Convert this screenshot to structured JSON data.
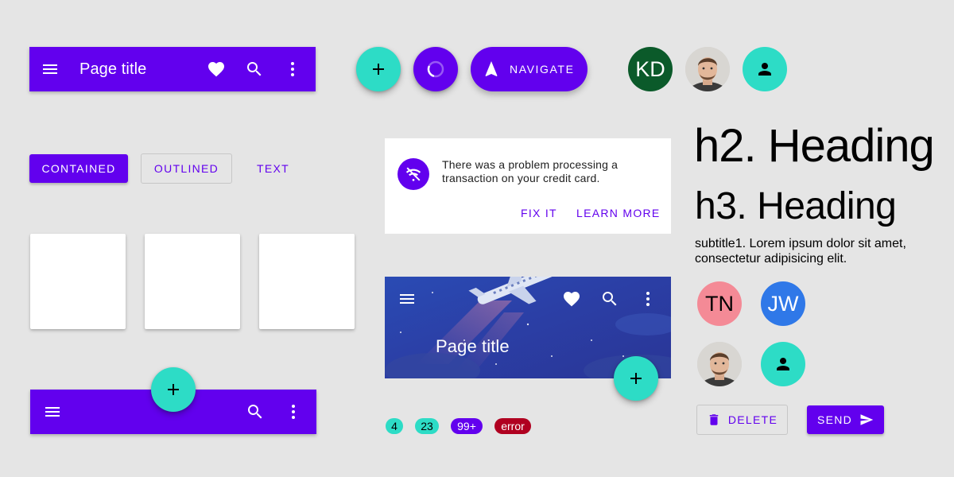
{
  "colors": {
    "primary": "#6200ee",
    "secondary": "#2ddcc6",
    "background": "#e5e5e5",
    "error": "#b00020",
    "avatar_kd": "#0b5a2a",
    "avatar_tn": "#f48a96",
    "avatar_jw": "#2f78e8"
  },
  "top_app_bar": {
    "title": "Page title",
    "icons": [
      "menu-icon",
      "favorite-icon",
      "search-icon",
      "more-vert-icon"
    ]
  },
  "fabs": {
    "add_icon": "add-icon",
    "progress_icon": "progress-icon",
    "navigate_label": "NAVIGATE",
    "navigate_icon": "navigation-arrow-icon"
  },
  "avatars_top": [
    {
      "kind": "initials",
      "text": "KD"
    },
    {
      "kind": "photo"
    },
    {
      "kind": "icon",
      "icon": "person-icon"
    }
  ],
  "buttons": {
    "contained": "CONTAINED",
    "outlined": "OUTLINED",
    "text": "TEXT"
  },
  "banner": {
    "icon": "wifi-off-icon",
    "message": "There was a problem processing a transaction on your credit card.",
    "action_fix": "FIX IT",
    "action_learn": "LEARN MORE"
  },
  "typography": {
    "h2": "h2. Heading",
    "h3": "h3. Heading",
    "subtitle1": "subtitle1. Lorem ipsum dolor sit amet, consectetur adipisicing elit."
  },
  "avatars_grid": [
    {
      "kind": "initials",
      "text": "TN"
    },
    {
      "kind": "initials",
      "text": "JW"
    },
    {
      "kind": "photo"
    },
    {
      "kind": "icon",
      "icon": "person-icon"
    }
  ],
  "prominent_app_bar": {
    "title": "Page title"
  },
  "bottom_app_bar": {
    "icons": [
      "menu-icon",
      "search-icon",
      "more-vert-icon"
    ]
  },
  "badges": [
    "4",
    "23",
    "99+",
    "error"
  ],
  "action_buttons": {
    "delete": "DELETE",
    "send": "SEND"
  }
}
